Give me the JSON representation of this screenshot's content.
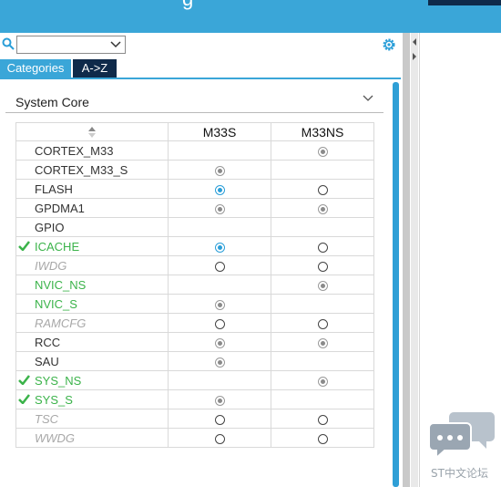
{
  "topbar": {
    "title_partial": "g"
  },
  "search": {
    "value": ""
  },
  "tabs": [
    {
      "label": "Categories"
    },
    {
      "label": "A->Z"
    }
  ],
  "section": {
    "title": "System Core"
  },
  "table": {
    "columns": [
      "M33S",
      "M33NS"
    ],
    "rows": [
      {
        "name": "CORTEX_M33",
        "style": "normal",
        "checked": false,
        "m33s": "none",
        "m33ns": "gray"
      },
      {
        "name": "CORTEX_M33_S",
        "style": "normal",
        "checked": false,
        "m33s": "gray",
        "m33ns": "none"
      },
      {
        "name": "FLASH",
        "style": "normal",
        "checked": false,
        "m33s": "blue",
        "m33ns": "empty"
      },
      {
        "name": "GPDMA1",
        "style": "normal",
        "checked": false,
        "m33s": "gray",
        "m33ns": "gray"
      },
      {
        "name": "GPIO",
        "style": "normal",
        "checked": false,
        "m33s": "none",
        "m33ns": "none"
      },
      {
        "name": "ICACHE",
        "style": "green",
        "checked": true,
        "m33s": "blue",
        "m33ns": "empty"
      },
      {
        "name": "IWDG",
        "style": "gray",
        "checked": false,
        "m33s": "empty",
        "m33ns": "empty"
      },
      {
        "name": "NVIC_NS",
        "style": "green",
        "checked": false,
        "m33s": "none",
        "m33ns": "gray"
      },
      {
        "name": "NVIC_S",
        "style": "green",
        "checked": false,
        "m33s": "gray",
        "m33ns": "none"
      },
      {
        "name": "RAMCFG",
        "style": "gray",
        "checked": false,
        "m33s": "empty",
        "m33ns": "empty"
      },
      {
        "name": "RCC",
        "style": "normal",
        "checked": false,
        "m33s": "gray",
        "m33ns": "gray"
      },
      {
        "name": "SAU",
        "style": "normal",
        "checked": false,
        "m33s": "gray",
        "m33ns": "none"
      },
      {
        "name": "SYS_NS",
        "style": "green",
        "checked": true,
        "m33s": "none",
        "m33ns": "gray"
      },
      {
        "name": "SYS_S",
        "style": "green",
        "checked": true,
        "m33s": "gray",
        "m33ns": "none"
      },
      {
        "name": "TSC",
        "style": "gray",
        "checked": false,
        "m33s": "empty",
        "m33ns": "empty"
      },
      {
        "name": "WWDG",
        "style": "gray",
        "checked": false,
        "m33s": "empty",
        "m33ns": "empty"
      }
    ]
  },
  "watermark": {
    "text": "ST中文论坛"
  },
  "colors": {
    "accent": "#3aa6d8",
    "dark_tab": "#0f2a4a",
    "green": "#3bb34a",
    "disabled": "#a8a8a8"
  },
  "icons": [
    "search-icon",
    "chevron-down-icon",
    "gear-icon",
    "sort-icon",
    "checkmark-icon",
    "chat-bubbles-icon"
  ]
}
